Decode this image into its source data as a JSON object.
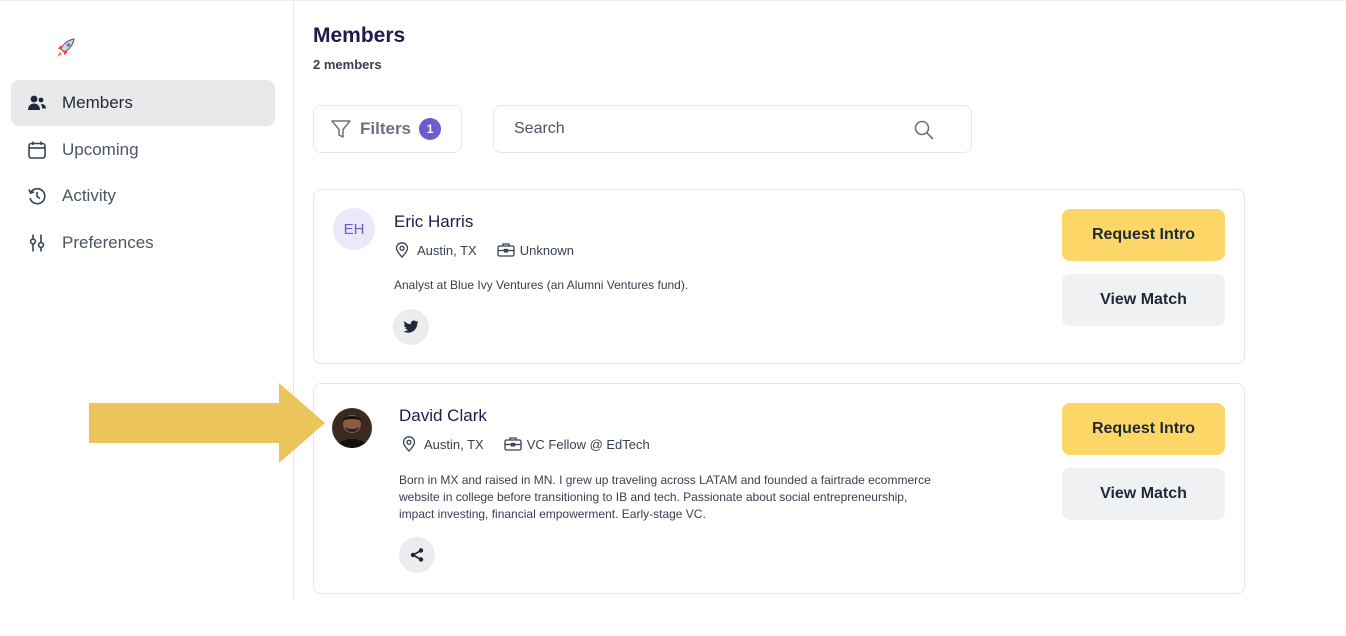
{
  "sidebar": {
    "logo_icon": "rocket-icon",
    "items": [
      {
        "label": "Members",
        "icon": "users-icon",
        "active": true
      },
      {
        "label": "Upcoming",
        "icon": "calendar-icon",
        "active": false
      },
      {
        "label": "Activity",
        "icon": "history-icon",
        "active": false
      },
      {
        "label": "Preferences",
        "icon": "sliders-icon",
        "active": false
      }
    ]
  },
  "header": {
    "title": "Members",
    "subtitle": "2 members"
  },
  "toolbar": {
    "filters_label": "Filters",
    "filters_count": "1",
    "search_placeholder": "Search"
  },
  "members": [
    {
      "initials": "EH",
      "name": "Eric Harris",
      "location": "Austin, TX",
      "role": "Unknown",
      "bio": "Analyst at Blue Ivy Ventures (an Alumni Ventures fund).",
      "social_icon": "twitter-icon",
      "request_label": "Request Intro",
      "view_label": "View Match"
    },
    {
      "initials": "",
      "name": "David Clark",
      "location": "Austin, TX",
      "role": "VC Fellow @ EdTech",
      "bio_lines": [
        "Born in MX and raised in MN. I grew up traveling across LATAM and founded a fairtrade ecommerce",
        "website in college before transitioning to IB and tech. Passionate about social entrepreneurship,",
        "impact investing, financial empowerment. Early-stage VC."
      ],
      "social_icon": "share-icon",
      "request_label": "Request Intro",
      "view_label": "View Match"
    }
  ],
  "colors": {
    "accent_yellow": "#fcd768",
    "accent_purple": "#6d5bd0",
    "arrow": "#ecc55a",
    "title_navy": "#1e1b4b"
  }
}
